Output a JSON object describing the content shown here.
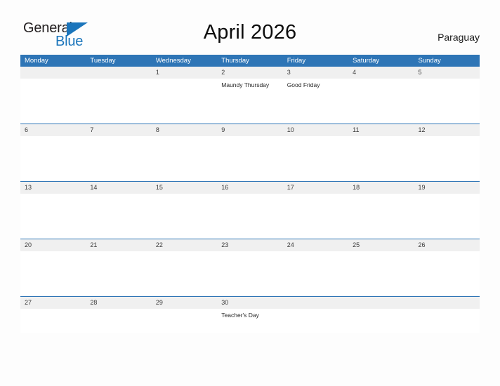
{
  "brand": {
    "name_part1": "General",
    "name_part2": "Blue",
    "triangle_icon": "triangle-icon",
    "accent_color": "#1b75bb"
  },
  "header": {
    "title": "April 2026",
    "country": "Paraguay"
  },
  "colors": {
    "header_blue": "#2e75b6",
    "row_divider_blue": "#2e75b6",
    "number_band_gray": "#f0f0f0",
    "page_background": "#fdfdfd",
    "day_number_text": "#3a3a3a",
    "event_text": "#262626"
  },
  "calendar": {
    "month": "April",
    "year": "2026",
    "weekday_headers": [
      "Monday",
      "Tuesday",
      "Wednesday",
      "Thursday",
      "Friday",
      "Saturday",
      "Sunday"
    ],
    "weeks": [
      {
        "days": [
          {
            "number": "",
            "events": []
          },
          {
            "number": "",
            "events": []
          },
          {
            "number": "1",
            "events": []
          },
          {
            "number": "2",
            "events": [
              "Maundy Thursday"
            ]
          },
          {
            "number": "3",
            "events": [
              "Good Friday"
            ]
          },
          {
            "number": "4",
            "events": []
          },
          {
            "number": "5",
            "events": []
          }
        ]
      },
      {
        "days": [
          {
            "number": "6",
            "events": []
          },
          {
            "number": "7",
            "events": []
          },
          {
            "number": "8",
            "events": []
          },
          {
            "number": "9",
            "events": []
          },
          {
            "number": "10",
            "events": []
          },
          {
            "number": "11",
            "events": []
          },
          {
            "number": "12",
            "events": []
          }
        ]
      },
      {
        "days": [
          {
            "number": "13",
            "events": []
          },
          {
            "number": "14",
            "events": []
          },
          {
            "number": "15",
            "events": []
          },
          {
            "number": "16",
            "events": []
          },
          {
            "number": "17",
            "events": []
          },
          {
            "number": "18",
            "events": []
          },
          {
            "number": "19",
            "events": []
          }
        ]
      },
      {
        "days": [
          {
            "number": "20",
            "events": []
          },
          {
            "number": "21",
            "events": []
          },
          {
            "number": "22",
            "events": []
          },
          {
            "number": "23",
            "events": []
          },
          {
            "number": "24",
            "events": []
          },
          {
            "number": "25",
            "events": []
          },
          {
            "number": "26",
            "events": []
          }
        ]
      },
      {
        "days": [
          {
            "number": "27",
            "events": []
          },
          {
            "number": "28",
            "events": []
          },
          {
            "number": "29",
            "events": []
          },
          {
            "number": "30",
            "events": [
              "Teacher's Day"
            ]
          },
          {
            "number": "",
            "events": []
          },
          {
            "number": "",
            "events": []
          },
          {
            "number": "",
            "events": []
          }
        ]
      }
    ]
  }
}
